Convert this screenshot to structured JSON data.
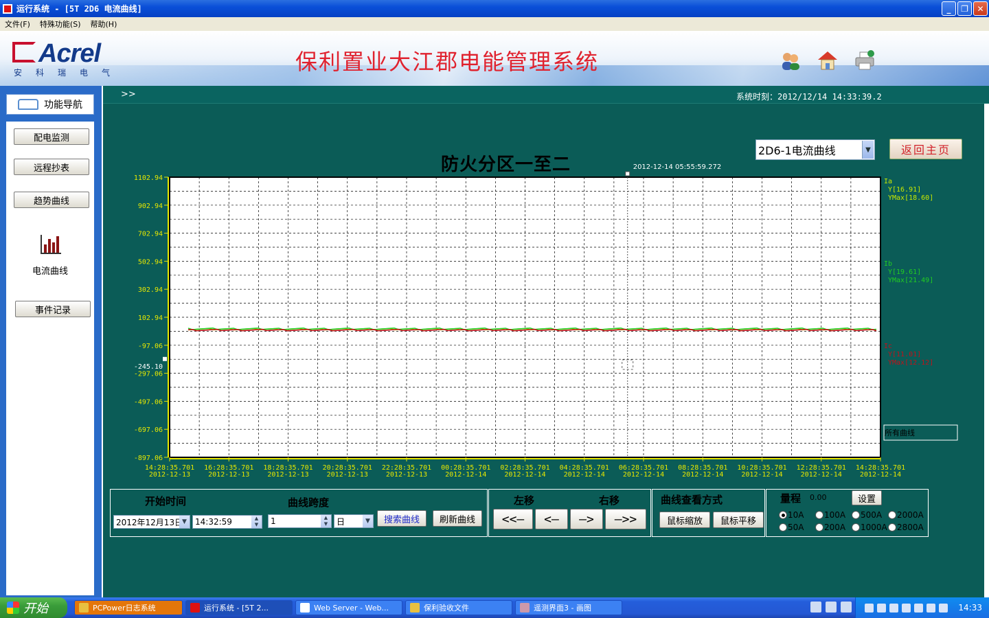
{
  "window": {
    "title": "运行系统 - [5T 2D6 电流曲线]",
    "buttons": [
      "_",
      "❐",
      "✕"
    ]
  },
  "menu": [
    "文件(F)",
    "特殊功能(S)",
    "帮助(H)"
  ],
  "banner": {
    "logo_text": "Acrel",
    "logo_sub": "安科瑞电气",
    "system_title": "保利置业大江郡电能管理系统",
    "icons": [
      "users-icon",
      "home-icon",
      "printer-icon"
    ]
  },
  "nav": {
    "header": "功能导航",
    "items": [
      "配电监测",
      "远程抄表",
      "趋势曲线",
      "电流曲线",
      "事件记录"
    ]
  },
  "status": {
    "arrow": ">>",
    "clock": "系统时刻：2012/12/14  14:33:39.2"
  },
  "curve_select": "2D6-1电流曲线",
  "home_button": "返回主页",
  "chart_data": {
    "type": "line",
    "title": "防火分区一至二",
    "cursor_time": "2012-12-14 05:55:59.272",
    "y_ticks": [
      "1102.94",
      "902.94",
      "702.94",
      "502.94",
      "302.94",
      "102.94",
      "-97.06",
      "-297.06",
      "-497.06",
      "-697.06",
      "-897.06"
    ],
    "ylim": [
      -897.06,
      1102.94
    ],
    "cursor_value": "-245.10",
    "x_ticks": [
      [
        "14:28:35.701",
        "2012-12-13"
      ],
      [
        "16:28:35.701",
        "2012-12-13"
      ],
      [
        "18:28:35.701",
        "2012-12-13"
      ],
      [
        "20:28:35.701",
        "2012-12-13"
      ],
      [
        "22:28:35.701",
        "2012-12-13"
      ],
      [
        "00:28:35.701",
        "2012-12-14"
      ],
      [
        "02:28:35.701",
        "2012-12-14"
      ],
      [
        "04:28:35.701",
        "2012-12-14"
      ],
      [
        "06:28:35.701",
        "2012-12-14"
      ],
      [
        "08:28:35.701",
        "2012-12-14"
      ],
      [
        "10:28:35.701",
        "2012-12-14"
      ],
      [
        "12:28:35.701",
        "2012-12-14"
      ],
      [
        "14:28:35.701",
        "2012-12-14"
      ]
    ],
    "series": [
      {
        "name": "Ia",
        "y_label": "Y[16.91]",
        "ymax_label": "YMax[18.60]",
        "color": "#c8e800",
        "value": 16.91
      },
      {
        "name": "Ib",
        "y_label": "Y[19.61]",
        "ymax_label": "YMax[21.49]",
        "color": "#22cc22",
        "value": 19.61
      },
      {
        "name": "Ic",
        "y_label": "Y[11.01]",
        "ymax_label": "YMax[12.12]",
        "color": "#c0121a",
        "value": 11.01
      }
    ],
    "legend_box": "所有曲线",
    "grid": true
  },
  "controls": {
    "start_label": "开始时间",
    "span_label": "曲线跨度",
    "date_value": "2012年12月13日",
    "time_value": "14:32:59",
    "span_value": "1",
    "span_unit": "日",
    "search_btn": "搜索曲线",
    "refresh_btn": "刷新曲线",
    "left_label": "左移",
    "right_label": "右移",
    "nav_btns": [
      "<<—",
      "<—",
      "—>",
      "—>>"
    ],
    "view_label": "曲线查看方式",
    "zoom_btn": "鼠标缩放",
    "pan_btn": "鼠标平移",
    "range_label": "量程",
    "range_value": "0.00",
    "set_btn": "设置",
    "ranges_row1": [
      "10A",
      "100A",
      "500A",
      "2000A"
    ],
    "ranges_row2": [
      "50A",
      "200A",
      "1000A",
      "2800A"
    ]
  },
  "taskbar": {
    "start": "开始",
    "tasks": [
      "PCPower日志系统",
      "运行系统 - [5T 2...",
      "Web Server - Web...",
      "保利验收文件",
      "遥测界面3 - 画图"
    ],
    "clock": "14:33"
  }
}
